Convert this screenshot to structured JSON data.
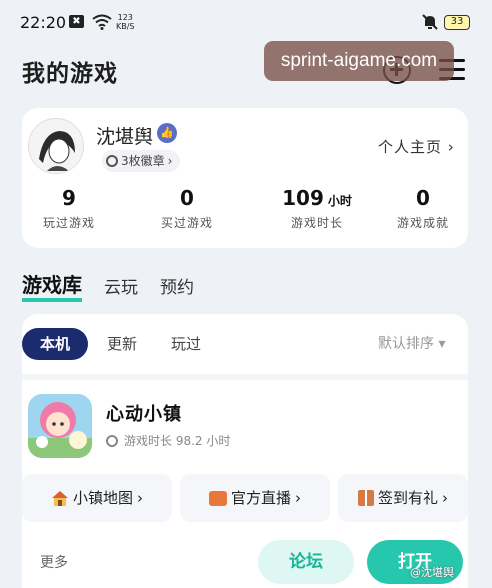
{
  "status": {
    "time": "22:20",
    "notif_glyph": "✖",
    "speed_value": "123",
    "speed_unit": "KB/S",
    "battery": "33",
    "wifi_icon": "wifi-icon",
    "bell_icon": "bell-muted-icon"
  },
  "header": {
    "title": "我的游戏",
    "watermark": "sprint-aigame.com",
    "add_icon": "plus-circle-icon",
    "menu_icon": "hamburger-menu-icon"
  },
  "profile": {
    "username": "沈堪舆",
    "verified_glyph": "👍",
    "badges": "3枚徽章",
    "badges_arrow": "›",
    "homepage": "个人主页",
    "homepage_arrow": "›",
    "stats": [
      {
        "value": "9",
        "unit": "",
        "label": "玩过游戏"
      },
      {
        "value": "0",
        "unit": "",
        "label": "买过游戏"
      },
      {
        "value": "109",
        "unit": "小时",
        "label": "游戏时长"
      },
      {
        "value": "0",
        "unit": "",
        "label": "游戏成就"
      }
    ]
  },
  "tabs": [
    "游戏库",
    "云玩",
    "预约"
  ],
  "library": {
    "filters": [
      "本机",
      "更新",
      "玩过"
    ],
    "sort": "默认排序",
    "sort_arrow": "▾",
    "game": {
      "title": "心动小镇",
      "playtime": "游戏时长 98.2 小时"
    },
    "actions": [
      {
        "label": "小镇地图",
        "arrow": "›",
        "icon": "house-icon"
      },
      {
        "label": "官方直播",
        "arrow": "›",
        "icon": "tv-icon"
      },
      {
        "label": "签到有礼",
        "arrow": "›",
        "icon": "gift-icon"
      }
    ],
    "more": "更多",
    "forum_button": "论坛",
    "open_button": "打开"
  },
  "footer_watermark": "@沈堪舆",
  "colors": {
    "accent": "#27c7ad",
    "filter_active": "#1c2a6e",
    "background": "#eef1f6"
  }
}
